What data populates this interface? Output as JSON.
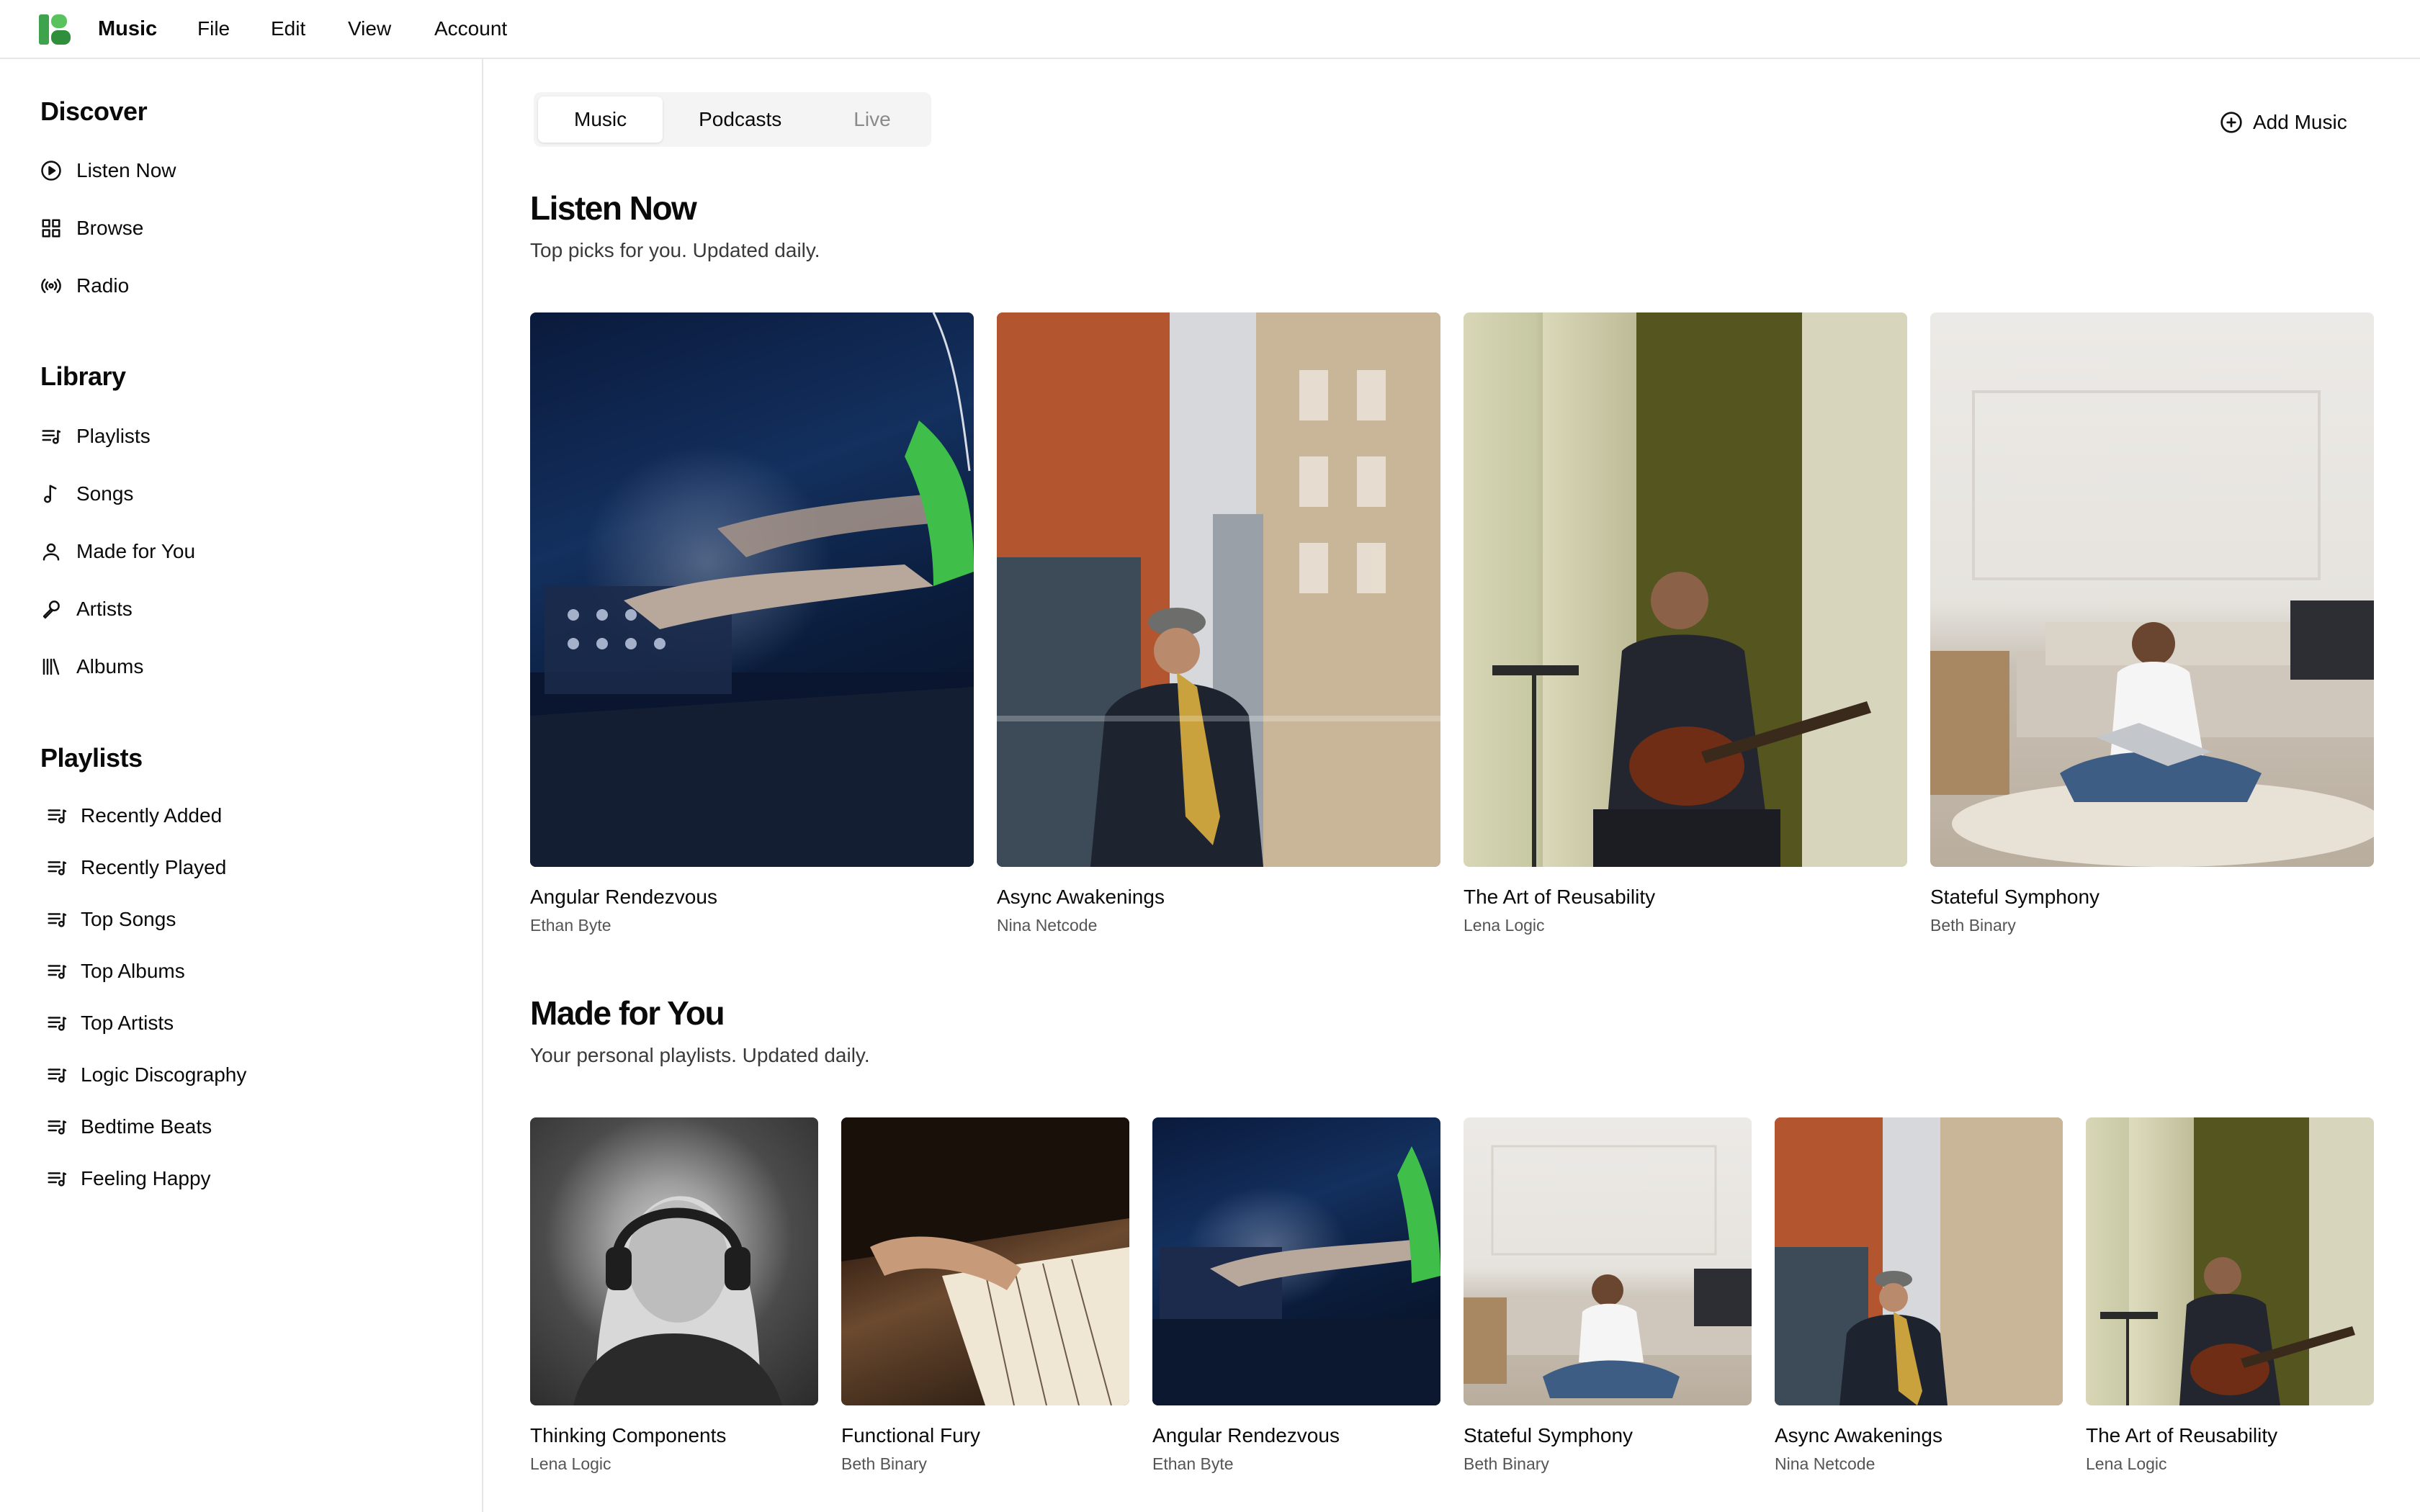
{
  "menubar": {
    "app_name": "Music",
    "items": [
      "File",
      "Edit",
      "View",
      "Account"
    ]
  },
  "sidebar": {
    "discover": {
      "heading": "Discover",
      "items": [
        {
          "label": "Listen Now",
          "icon": "play-circle-icon"
        },
        {
          "label": "Browse",
          "icon": "grid-icon"
        },
        {
          "label": "Radio",
          "icon": "radio-icon"
        }
      ]
    },
    "library": {
      "heading": "Library",
      "items": [
        {
          "label": "Playlists",
          "icon": "playlist-icon"
        },
        {
          "label": "Songs",
          "icon": "music-note-icon"
        },
        {
          "label": "Made for You",
          "icon": "user-icon"
        },
        {
          "label": "Artists",
          "icon": "microphone-icon"
        },
        {
          "label": "Albums",
          "icon": "library-icon"
        }
      ]
    },
    "playlists": {
      "heading": "Playlists",
      "items": [
        "Recently Added",
        "Recently Played",
        "Top Songs",
        "Top Albums",
        "Top Artists",
        "Logic Discography",
        "Bedtime Beats",
        "Feeling Happy"
      ]
    }
  },
  "main": {
    "tabs": [
      {
        "label": "Music",
        "state": "active"
      },
      {
        "label": "Podcasts",
        "state": "normal"
      },
      {
        "label": "Live",
        "state": "disabled"
      }
    ],
    "add_music_label": "Add Music",
    "listen_now": {
      "title": "Listen Now",
      "subtitle": "Top picks for you. Updated daily.",
      "albums": [
        {
          "title": "Angular Rendezvous",
          "artist": "Ethan Byte"
        },
        {
          "title": "Async Awakenings",
          "artist": "Nina Netcode"
        },
        {
          "title": "The Art of Reusability",
          "artist": "Lena Logic"
        },
        {
          "title": "Stateful Symphony",
          "artist": "Beth Binary"
        }
      ]
    },
    "made_for_you": {
      "title": "Made for You",
      "subtitle": "Your personal playlists. Updated daily.",
      "albums": [
        {
          "title": "Thinking Components",
          "artist": "Lena Logic"
        },
        {
          "title": "Functional Fury",
          "artist": "Beth Binary"
        },
        {
          "title": "Angular Rendezvous",
          "artist": "Ethan Byte"
        },
        {
          "title": "Stateful Symphony",
          "artist": "Beth Binary"
        },
        {
          "title": "Async Awakenings",
          "artist": "Nina Netcode"
        },
        {
          "title": "The Art of Reusability",
          "artist": "Lena Logic"
        }
      ]
    }
  },
  "colors": {
    "brand_logo": "#3fa34d",
    "border": "#e6e6e6",
    "muted_text": "#8a8a8a"
  }
}
